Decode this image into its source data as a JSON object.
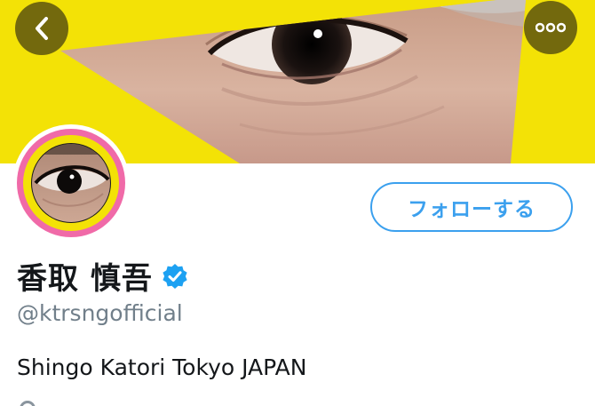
{
  "header": {
    "back_icon": "chevron-left-icon",
    "more_icon": "more-dots-icon"
  },
  "profile": {
    "display_name": "香取 慎吾",
    "verified_icon": "verified-badge-icon",
    "handle": "@ktrsngofficial",
    "bio": "Shingo Katori Tokyo JAPAN",
    "follow_label": "フォローする",
    "location_icon": "location-pin-icon"
  },
  "colors": {
    "banner_yellow": "#f3e206",
    "accent_blue": "#3ba0ee",
    "avatar_ring_pink": "#f06aa8",
    "avatar_ring_yellow": "#f3e206",
    "handle_gray": "#717f8a"
  }
}
